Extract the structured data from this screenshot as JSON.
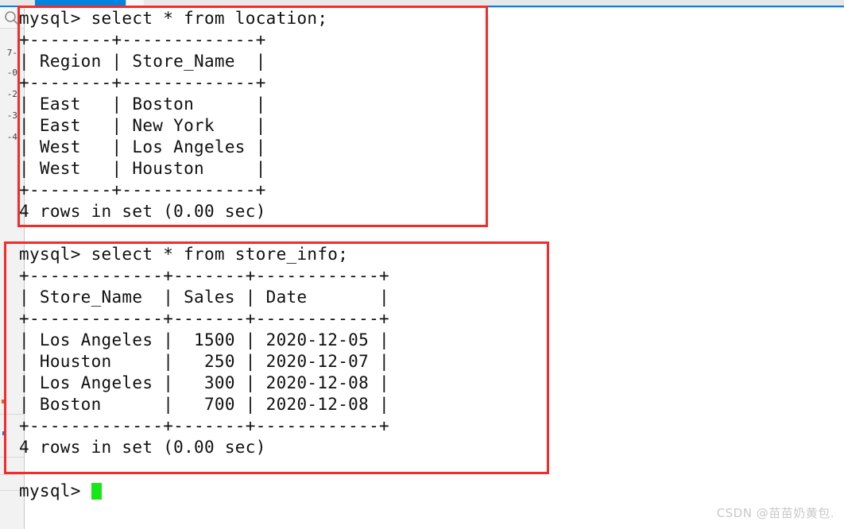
{
  "chrome": {
    "active_tab_color": "#0084e0",
    "inactive_tab_color": "#f7f7f7",
    "strip_color": "#e8e8e8"
  },
  "sidebar": {
    "search_icon": "search-icon",
    "clipped_fragments": [
      {
        "text": "7-"
      },
      {
        "text": "-0"
      },
      {
        "text": "-2"
      },
      {
        "text": "-3"
      },
      {
        "text": "-4"
      }
    ]
  },
  "annotations": {
    "accent_color": "#f22b2b",
    "box_location_label": "location-query-highlight",
    "box_storeinfo_label": "store-info-query-highlight"
  },
  "terminal": {
    "prompt": "mysql> ",
    "cursor_color": "#16e716",
    "blocks": [
      {
        "name": "location-query",
        "command": "mysql> select * from location;",
        "lines": [
          "mysql> select * from location;",
          "+--------+-------------+",
          "| Region | Store_Name  |",
          "+--------+-------------+",
          "| East   | Boston      |",
          "| East   | New York    |",
          "| West   | Los Angeles |",
          "| West   | Houston     |",
          "+--------+-------------+",
          "4 rows in set (0.00 sec)"
        ],
        "result_summary": "4 rows in set (0.00 sec)"
      },
      {
        "name": "store-info-query",
        "command": "mysql> select * from store_info;",
        "lines": [
          "mysql> select * from store_info;",
          "+-------------+-------+------------+",
          "| Store_Name  | Sales | Date       |",
          "+-------------+-------+------------+",
          "| Los Angeles |  1500 | 2020-12-05 |",
          "| Houston     |   250 | 2020-12-07 |",
          "| Los Angeles |   300 | 2020-12-08 |",
          "| Boston      |   700 | 2020-12-08 |",
          "+-------------+-------+------------+",
          "4 rows in set (0.00 sec)"
        ],
        "result_summary": "4 rows in set (0.00 sec)"
      }
    ],
    "final_prompt": "mysql> "
  },
  "tables": {
    "location": {
      "columns": [
        "Region",
        "Store_Name"
      ],
      "rows": [
        [
          "East",
          "Boston"
        ],
        [
          "East",
          "New York"
        ],
        [
          "West",
          "Los Angeles"
        ],
        [
          "West",
          "Houston"
        ]
      ],
      "row_count_text": "4 rows in set (0.00 sec)"
    },
    "store_info": {
      "columns": [
        "Store_Name",
        "Sales",
        "Date"
      ],
      "rows": [
        [
          "Los Angeles",
          "1500",
          "2020-12-05"
        ],
        [
          "Houston",
          "250",
          "2020-12-07"
        ],
        [
          "Los Angeles",
          "300",
          "2020-12-08"
        ],
        [
          "Boston",
          "700",
          "2020-12-08"
        ]
      ],
      "row_count_text": "4 rows in set (0.00 sec)"
    }
  },
  "watermark": {
    "text": "CSDN @苗苗奶黄包.",
    "color": "#c9c9c9"
  }
}
